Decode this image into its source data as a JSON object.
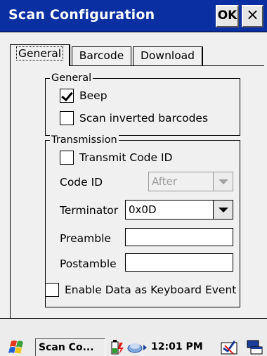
{
  "window": {
    "title": "Scan Configuration",
    "ok_label": "OK",
    "close_label": "×"
  },
  "tabs": [
    {
      "label": "General",
      "active": true
    },
    {
      "label": "Barcode",
      "active": false
    },
    {
      "label": "Download",
      "active": false
    }
  ],
  "general_group": {
    "label": "General",
    "beep": {
      "label": "Beep",
      "checked": true
    },
    "scan_inverted": {
      "label": "Scan inverted barcodes",
      "checked": false
    }
  },
  "transmission_group": {
    "label": "Transmission",
    "transmit_code_id": {
      "label": "Transmit Code ID",
      "checked": false
    },
    "code_id": {
      "label": "Code ID",
      "value": "After",
      "enabled": false
    },
    "terminator": {
      "label": "Terminator",
      "value": "0x0D"
    },
    "preamble": {
      "label": "Preamble",
      "value": ""
    },
    "postamble": {
      "label": "Postamble",
      "value": ""
    }
  },
  "keyboard_event": {
    "label": "Enable Data as Keyboard Event",
    "checked": false
  },
  "taskbar": {
    "task_label": "Scan Co...",
    "clock": "12:01 PM"
  },
  "colors": {
    "titlebar": "#0a2fa3",
    "dialog_bg": "#f0f0f0"
  }
}
